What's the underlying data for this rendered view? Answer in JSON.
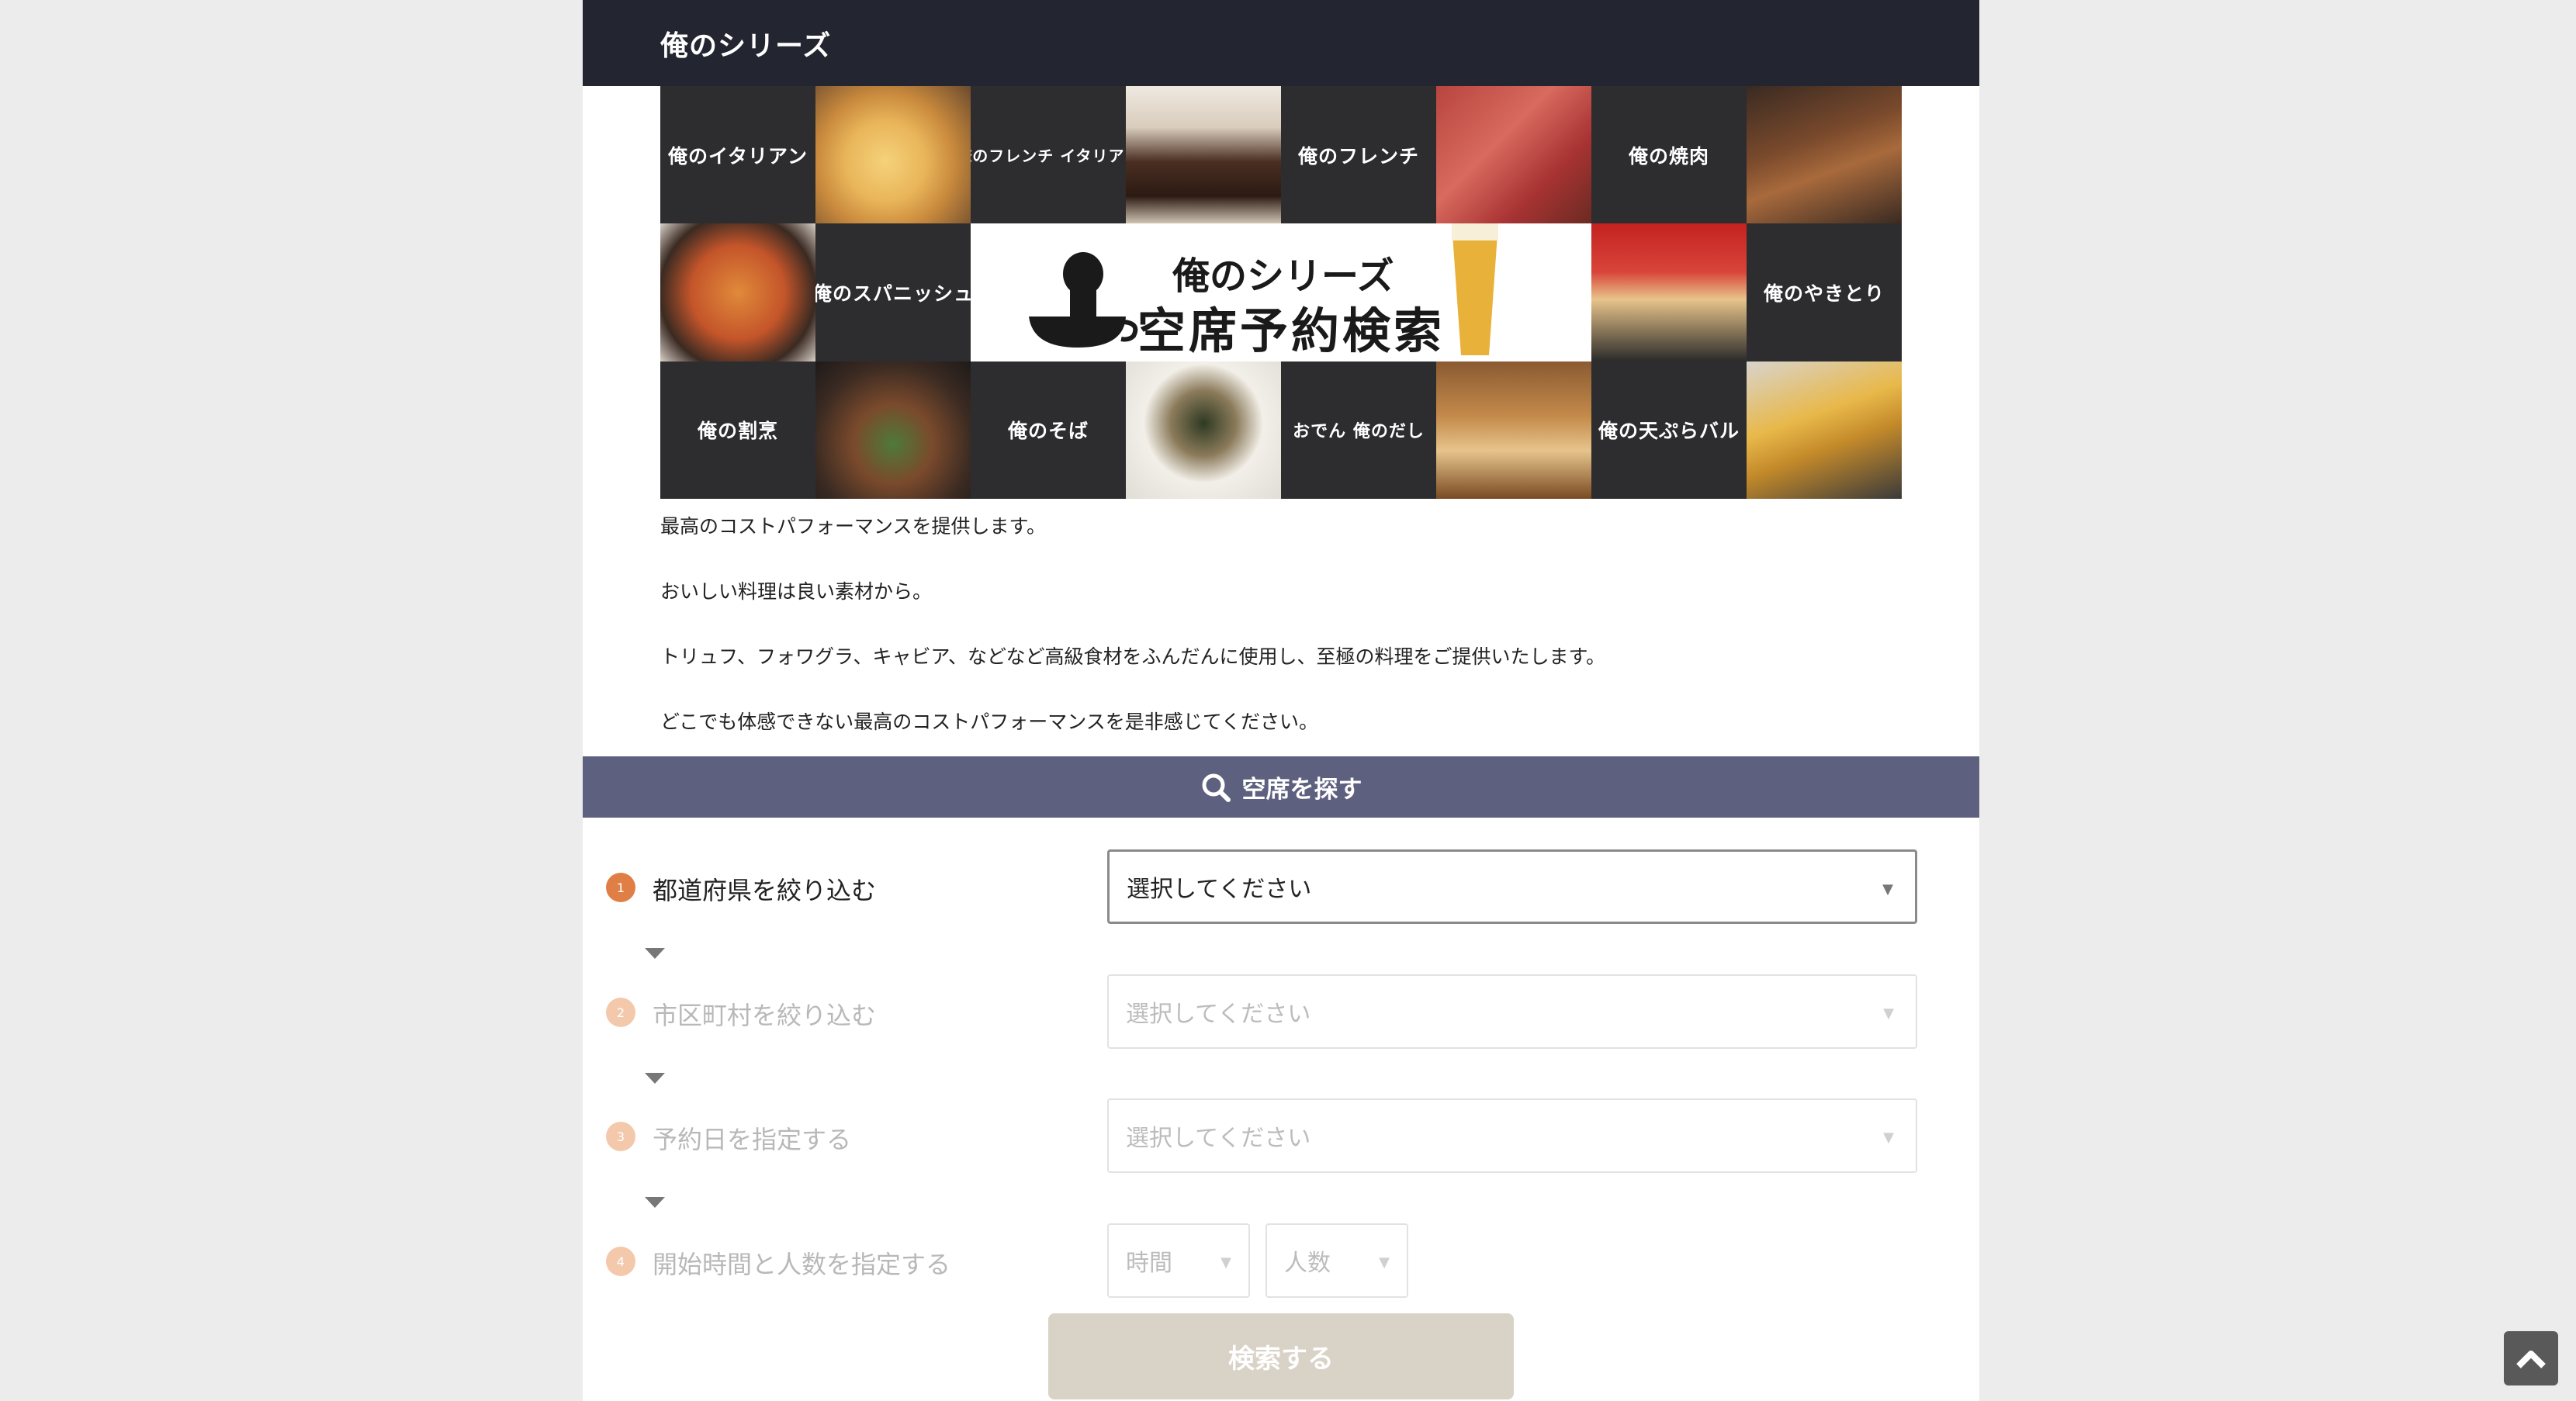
{
  "header": {
    "title": "俺のシリーズ"
  },
  "banner": {
    "tiles": [
      {
        "label": "俺のイタリアン"
      },
      {
        "label": "俺のフレンチ イタリアン"
      },
      {
        "label": "俺のフレンチ"
      },
      {
        "label": "俺の焼肉"
      },
      {
        "label": "俺のスパニッシュ"
      },
      {
        "label": "俺のやきとり"
      },
      {
        "label": "俺の割烹"
      },
      {
        "label": "俺のそば"
      },
      {
        "label": "おでん 俺のだし"
      },
      {
        "label": "俺の天ぷらバル"
      }
    ],
    "center_line1": "俺のシリーズ",
    "center_line2": "空席予約検索"
  },
  "description": [
    "最高のコストパフォーマンスを提供します。",
    "おいしい料理は良い素材から。",
    "トリュフ、フォワグラ、キャビア、などなど高級食材をふんだんに使用し、至極の料理をご提供いたします。",
    "どこでも体感できない最高のコストパフォーマンスを是非感じてください。"
  ],
  "search": {
    "header": "空席を探す",
    "steps": [
      {
        "num": "1",
        "label": "都道府県を絞り込む",
        "value": "選択してください",
        "active": true
      },
      {
        "num": "2",
        "label": "市区町村を絞り込む",
        "value": "選択してください",
        "active": false
      },
      {
        "num": "3",
        "label": "予約日を指定する",
        "value": "選択してください",
        "active": false
      },
      {
        "num": "4",
        "label": "開始時間と人数を指定する",
        "time": "時間",
        "people": "人数",
        "active": false
      }
    ],
    "submit": "検索する"
  },
  "icons": {
    "search": "search-icon",
    "chevron": "chevron-down-icon",
    "to_top": "chevron-up-icon"
  },
  "colors": {
    "topbar": "#232530",
    "search_header": "#5e607f",
    "step_active": "#e07f45",
    "submit": "#d9d2c6"
  }
}
